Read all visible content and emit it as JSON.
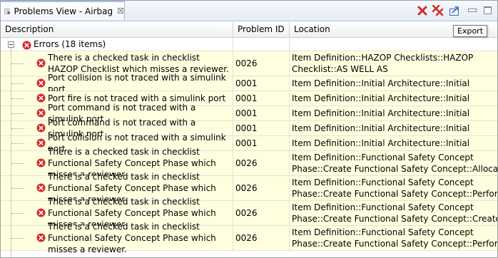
{
  "view": {
    "title": "Problems View - Airbag",
    "close_glyph": "☒",
    "tooltip": "Export"
  },
  "toolbar": {
    "delete_icon": "delete-icon",
    "delete_all_icon": "delete-all-icon",
    "export_icon": "export-icon",
    "minimize_icon": "minimize-icon",
    "maximize_icon": "maximize-icon"
  },
  "columns": {
    "description": "Description",
    "problem_id": "Problem ID",
    "location": "Location"
  },
  "group": {
    "label": "Errors (18 items)"
  },
  "rows": [
    {
      "desc": "There is a checked task in checklist HAZOP Checklist which misses a reviewer.",
      "pid": "0026",
      "loc1": "Item Definition::HAZOP Checklists::HAZOP",
      "loc2": "Checklist::AS WELL AS"
    },
    {
      "desc": "Port collision is not traced with a simulink port",
      "pid": "0001",
      "loc1": "Item Definition::Initial Architecture::Initial",
      "loc2": ""
    },
    {
      "desc": "Port fire is not traced with a simulink port",
      "pid": "0001",
      "loc1": "Item Definition::Initial Architecture::Initial",
      "loc2": ""
    },
    {
      "desc": "Port command is not traced with a simulink port",
      "pid": "0001",
      "loc1": "Item Definition::Initial Architecture::Initial",
      "loc2": ""
    },
    {
      "desc": "Port command is not traced with a simulink port",
      "pid": "0001",
      "loc1": "Item Definition::Initial Architecture::Initial",
      "loc2": ""
    },
    {
      "desc": "Port collision is not traced with a simulink port",
      "pid": "0001",
      "loc1": "Item Definition::Initial Architecture::Initial",
      "loc2": ""
    },
    {
      "desc": "There is a checked task in checklist Functional Safety Concept Phase which misses a reviewer.",
      "pid": "0026",
      "loc1": "Item Definition::Functional Safety Concept",
      "loc2": "Phase::Create Functional Safety Concept::Allocate"
    },
    {
      "desc": "There is a checked task in checklist Functional Safety Concept Phase which misses a reviewer.",
      "pid": "0026",
      "loc1": "Item Definition::Functional Safety Concept",
      "loc2": "Phase::Create Functional Safety Concept::Perform"
    },
    {
      "desc": "There is a checked task in checklist Functional Safety Concept Phase which misses a reviewer.",
      "pid": "0026",
      "loc1": "Item Definition::Functional Safety Concept",
      "loc2": "Phase::Create Functional Safety Concept::Create"
    },
    {
      "desc": "There is a checked task in checklist Functional Safety Concept Phase which misses a reviewer.",
      "pid": "0026",
      "loc1": "Item Definition::Functional Safety Concept",
      "loc2": "Phase::Create Functional Safety Concept::Perform"
    }
  ],
  "colors": {
    "error": "#d42b2b",
    "row_background": "#ffffe0",
    "tab_accent": "#a6c0e4"
  }
}
